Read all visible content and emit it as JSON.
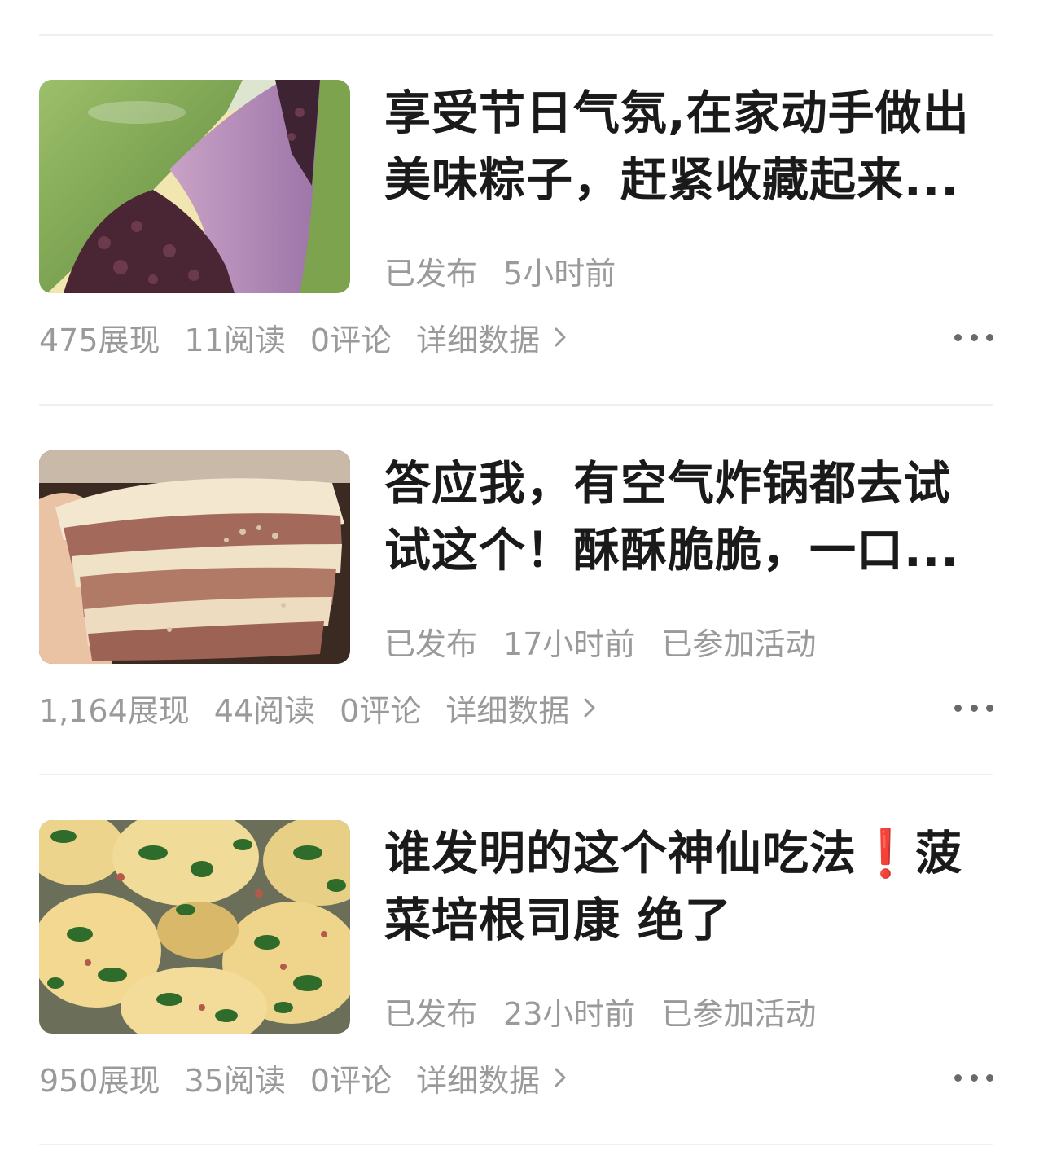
{
  "articles": [
    {
      "title": "享受节日气氛,在家动手做出美味粽子，赶紧收藏起来...",
      "status": "已发布",
      "time": "5小时前",
      "activity": "",
      "views": "475展现",
      "reads": "11阅读",
      "comments": "0评论",
      "detail_label": "详细数据",
      "thumbnail": "zongzi-photo"
    },
    {
      "title": "答应我，有空气炸锅都去试试这个！酥酥脆脆，一口...",
      "status": "已发布",
      "time": "17小时前",
      "activity": "已参加活动",
      "views": "1,164展现",
      "reads": "44阅读",
      "comments": "0评论",
      "detail_label": "详细数据",
      "thumbnail": "flaky-pastry-photo"
    },
    {
      "title_before": "谁发明的这个神仙吃法",
      "title_mark": "❗",
      "title_after": "菠菜培根司康 绝了",
      "status": "已发布",
      "time": "23小时前",
      "activity": "已参加活动",
      "views": "950展现",
      "reads": "35阅读",
      "comments": "0评论",
      "detail_label": "详细数据",
      "thumbnail": "spinach-scone-photo"
    }
  ],
  "icons": {
    "chevron": "chevron-right-icon",
    "more": "more-dots-icon"
  },
  "colors": {
    "text": "#1a1a1a",
    "muted": "#9a9a9a",
    "accent_red": "#e8202a",
    "divider": "#f0f0f0"
  }
}
